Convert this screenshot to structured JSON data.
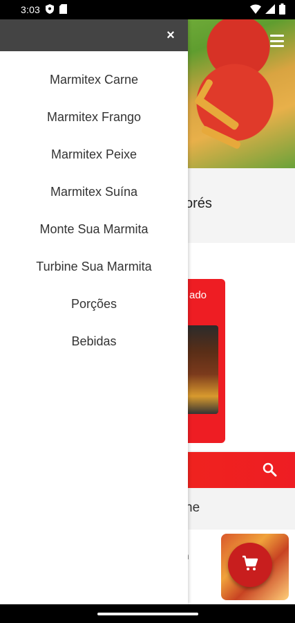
{
  "status_bar": {
    "time": "3:03"
  },
  "drawer": {
    "close_symbol": "×",
    "items": [
      {
        "label": "Marmitex Carne"
      },
      {
        "label": "Marmitex Frango"
      },
      {
        "label": "Marmitex Peixe"
      },
      {
        "label": "Marmitex Suína"
      },
      {
        "label": "Monte Sua Marmita"
      },
      {
        "label": "Turbine Sua Marmita"
      },
      {
        "label": "Porções"
      },
      {
        "label": "Bebidas"
      }
    ]
  },
  "background": {
    "store_name_partial": "orés",
    "promo_label_partial": "ado",
    "category_partial": "ne",
    "item_desc_partial": "m"
  },
  "colors": {
    "accent": "#ee1d23",
    "drawer_header": "#444444",
    "fab": "#c81e1e"
  },
  "icons": {
    "list": "list-icon",
    "search": "search-icon",
    "cart": "cart-icon",
    "close": "close-icon"
  }
}
